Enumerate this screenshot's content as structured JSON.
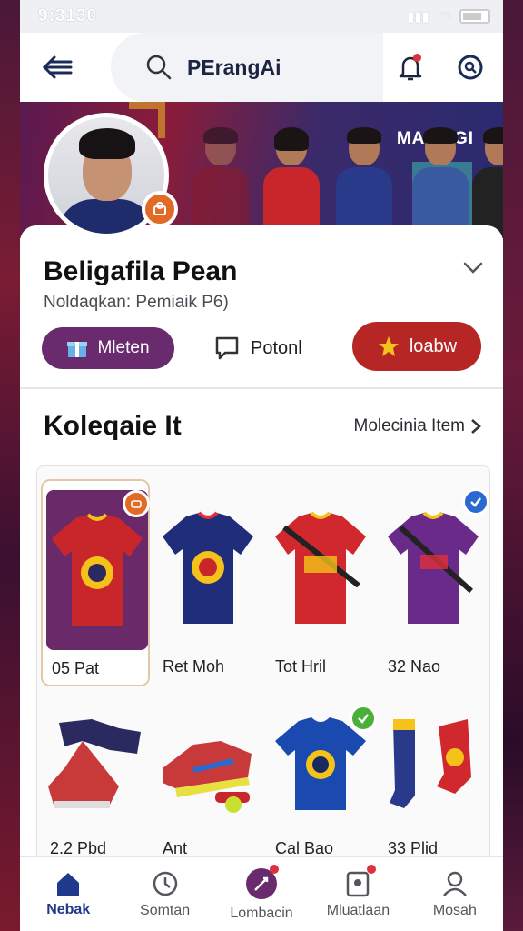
{
  "status_bar": {
    "time": "9:3130"
  },
  "app_bar": {
    "title": "PErangAi"
  },
  "hero": {
    "title": "MAMAGI"
  },
  "profile": {
    "name": "Beligafila Pean",
    "subtitle": "Noldaqkan: Pemiaik P6)",
    "primary_button": "Mleten",
    "secondary_button": "Potonl",
    "follow_button": "loabw"
  },
  "collection": {
    "title": "Koleqaie  It",
    "link": "Molecinia Item",
    "items": [
      {
        "label": "05  Pat",
        "color": "#c8262a",
        "type": "jersey",
        "tag": "orange"
      },
      {
        "label": "Ret  Moh",
        "color": "#1f2d7a",
        "type": "jersey",
        "tag": ""
      },
      {
        "label": "Tot  Hril",
        "color": "#d0282c",
        "type": "jersey-strap",
        "tag": ""
      },
      {
        "label": "32  Nao",
        "color": "#6a2a8a",
        "type": "jersey-strap",
        "tag": "blue"
      },
      {
        "label": "2.2  Pbd",
        "color": "#2a2a60",
        "type": "boots",
        "tag": ""
      },
      {
        "label": "Ant",
        "color": "#c83a3a",
        "type": "shoe",
        "tag": ""
      },
      {
        "label": "Cal  Bao",
        "color": "#1a4ab0",
        "type": "jersey",
        "tag": "green"
      },
      {
        "label": "33  Plid",
        "color": "#d0282c",
        "type": "socks",
        "tag": ""
      }
    ]
  },
  "bottom_nav": [
    {
      "label": "Nebak",
      "icon": "home-icon",
      "active": true
    },
    {
      "label": "Somtan",
      "icon": "clock-icon",
      "active": false
    },
    {
      "label": "Lombacin",
      "icon": "edit-icon",
      "active": false
    },
    {
      "label": "Mluatlaan",
      "icon": "document-icon",
      "active": false
    },
    {
      "label": "Mosah",
      "icon": "user-icon",
      "active": false
    }
  ],
  "colors": {
    "accent": "#b52624",
    "primary": "#6a2a6e",
    "nav_active": "#1f3a8a"
  }
}
